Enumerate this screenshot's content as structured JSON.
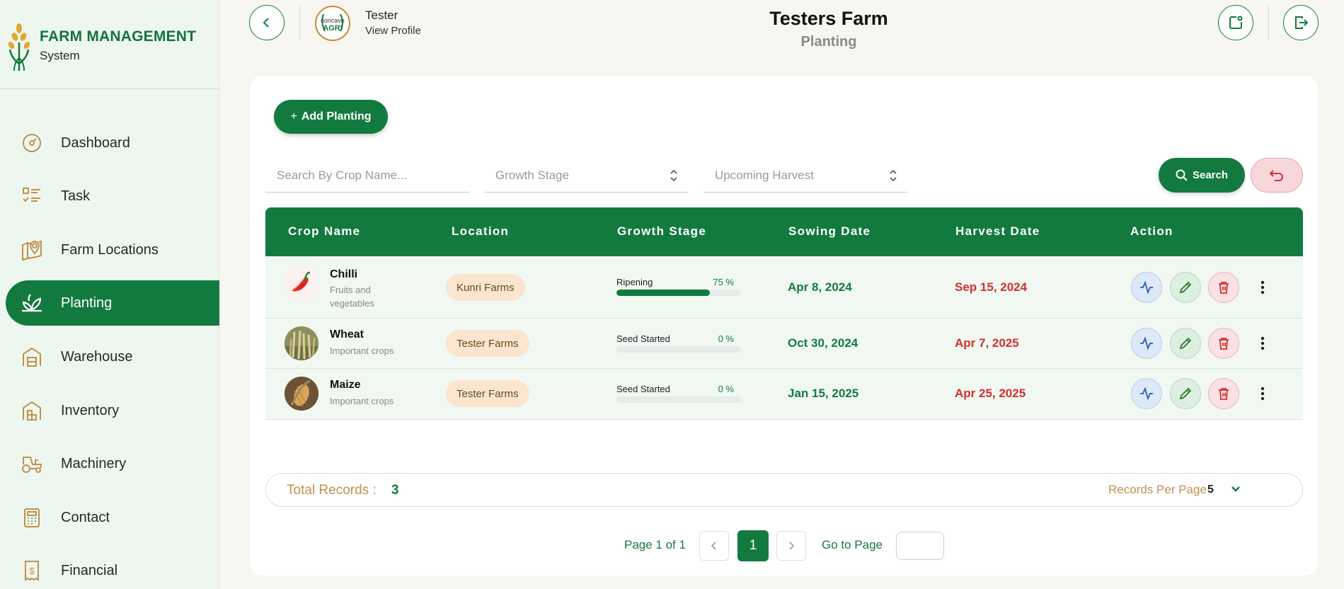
{
  "brand": {
    "title": "FARM MANAGEMENT",
    "subtitle": "System"
  },
  "sidebar": {
    "items": [
      {
        "label": "Dashboard",
        "icon": "gauge-icon"
      },
      {
        "label": "Task",
        "icon": "task-list-icon"
      },
      {
        "label": "Farm Locations",
        "icon": "map-pin-icon"
      },
      {
        "label": "Planting",
        "icon": "sprout-icon",
        "active": true
      },
      {
        "label": "Warehouse",
        "icon": "warehouse-icon"
      },
      {
        "label": "Inventory",
        "icon": "inventory-icon"
      },
      {
        "label": "Machinery",
        "icon": "tractor-icon"
      },
      {
        "label": "Contact",
        "icon": "contact-book-icon"
      },
      {
        "label": "Financial",
        "icon": "dollar-receipt-icon"
      }
    ]
  },
  "header": {
    "profile_name": "Tester",
    "profile_link": "View Profile",
    "logo_text": "Concave AGRI",
    "title": "Testers Farm",
    "subtitle": "Planting"
  },
  "toolbar": {
    "add_label": "Add Planting",
    "search_placeholder": "Search By Crop Name...",
    "growth_stage_placeholder": "Growth Stage",
    "upcoming_harvest_placeholder": "Upcoming Harvest",
    "search_label": "Search"
  },
  "table": {
    "columns": [
      "Crop Name",
      "Location",
      "Growth Stage",
      "Sowing Date",
      "Harvest Date",
      "Action"
    ],
    "rows": [
      {
        "crop": "Chilli",
        "category": "Fruits and vegetables",
        "location": "Kunri Farms",
        "stage": "Ripening",
        "progress_pct": "75 %",
        "progress": 0.75,
        "sowing": "Apr 8, 2024",
        "harvest": "Sep 15, 2024"
      },
      {
        "crop": "Wheat",
        "category": "Important crops",
        "location": "Tester Farms",
        "stage": "Seed Started",
        "progress_pct": "0 %",
        "progress": 0,
        "sowing": "Oct 30, 2024",
        "harvest": "Apr 7, 2025"
      },
      {
        "crop": "Maize",
        "category": "Important crops",
        "location": "Tester Farms",
        "stage": "Seed Started",
        "progress_pct": "0 %",
        "progress": 0,
        "sowing": "Jan 15, 2025",
        "harvest": "Apr 25, 2025"
      }
    ]
  },
  "footer": {
    "total_label": "Total Records :",
    "total_value": "3",
    "records_per_page_label": "Records Per Page",
    "records_per_page_value": "5",
    "page_info": "Page 1 of 1",
    "current_page": "1",
    "goto_label": "Go to Page"
  },
  "colors": {
    "primary": "#137a3f",
    "accent": "#c1904f",
    "danger": "#d32f2f"
  }
}
